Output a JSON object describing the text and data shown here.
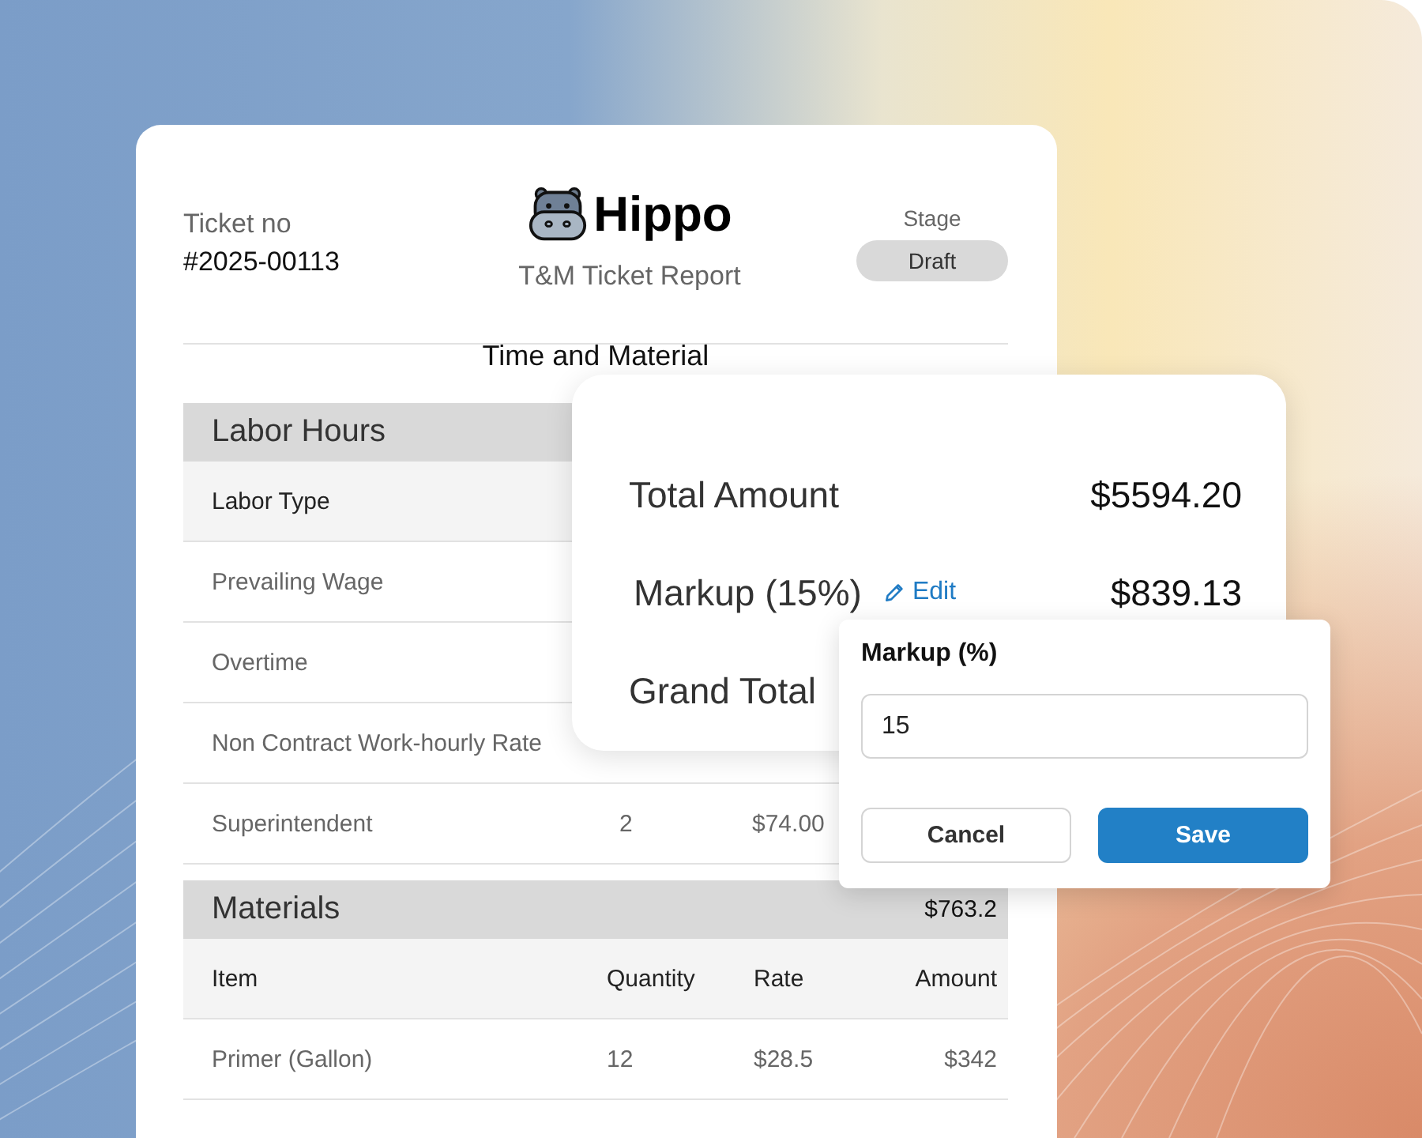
{
  "ticket": {
    "label": "Ticket no",
    "number": "#2025-00113"
  },
  "brand": {
    "name": "Hippo",
    "subtitle": "T&M Ticket Report"
  },
  "stage": {
    "label": "Stage",
    "value": "Draft"
  },
  "section_title": "Time and Material",
  "labor": {
    "title": "Labor Hours",
    "columns": [
      "Labor Type"
    ],
    "rows": [
      {
        "type": "Prevailing Wage"
      },
      {
        "type": "Overtime"
      },
      {
        "type": "Non Contract Work-hourly Rate"
      },
      {
        "type": "Superintendent",
        "quantity": "2",
        "rate": "$74.00"
      }
    ]
  },
  "materials": {
    "title": "Materials",
    "total": "$763.2",
    "columns": [
      "Item",
      "Quantity",
      "Rate",
      "Amount"
    ],
    "rows": [
      {
        "item": "Primer (Gallon)",
        "quantity": "12",
        "rate": "$28.5",
        "amount": "$342"
      }
    ]
  },
  "summary": {
    "rows": [
      {
        "label": "Total Amount",
        "value": "$5594.20"
      },
      {
        "label": "Markup (15%)",
        "action": "Edit",
        "value": "$839.13"
      },
      {
        "label": "Grand Total"
      }
    ]
  },
  "markup_popover": {
    "title": "Markup (%)",
    "value": "15",
    "buttons": [
      {
        "label": "Cancel",
        "kind": "secondary"
      },
      {
        "label": "Save",
        "kind": "primary"
      }
    ]
  }
}
